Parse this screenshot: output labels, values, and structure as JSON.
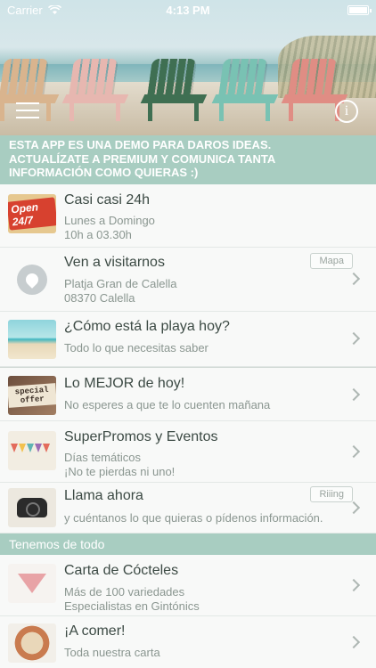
{
  "status_bar": {
    "carrier": "Carrier",
    "time": "4:13 PM"
  },
  "header": {
    "banner_lines": [
      "ESTA APP ES UNA DEMO PARA DAROS IDEAS.",
      "ACTUALÍZATE A PREMIUM Y COMUNICA TANTA",
      "INFORMACIÓN COMO QUIERAS :)"
    ]
  },
  "items": [
    {
      "title": "Casi casi 24h",
      "lines": [
        "Lunes a Domingo",
        "10h a 03.30h"
      ],
      "thumb_text": "Open 24/7"
    },
    {
      "title": "Ven a visitarnos",
      "lines": [
        "Platja Gran de Calella",
        "08370 Calella"
      ],
      "tag": "Mapa"
    },
    {
      "title": "¿Cómo está la playa hoy?",
      "lines": [
        "Todo lo que necesitas saber"
      ]
    },
    {
      "title": "Lo MEJOR de hoy!",
      "lines": [
        "No esperes a que te lo cuenten mañana"
      ],
      "thumb_text": "special offer"
    },
    {
      "title": "SuperPromos y Eventos",
      "lines": [
        "Días temáticos",
        "¡No te pierdas ni uno!"
      ]
    },
    {
      "title": "Llama ahora",
      "lines": [
        "y cuéntanos lo que quieras o pídenos información."
      ],
      "tag": "Riiing"
    }
  ],
  "section_title": "Tenemos de todo",
  "items2": [
    {
      "title": "Carta de Cócteles",
      "lines": [
        "Más de 100 variedades",
        "Especialistas en Gintónics"
      ]
    },
    {
      "title": "¡A comer!",
      "lines": [
        "Toda nuestra carta"
      ]
    }
  ],
  "colors": {
    "accent": "#a8cdc1",
    "title_text": "#3c4a44",
    "sub_text": "#8a9690"
  },
  "icons": {
    "menu": "hamburger-icon",
    "info": "info-icon",
    "pin": "location-pin-icon",
    "chevron": "chevron-right-icon",
    "wifi": "wifi-icon",
    "battery": "battery-icon"
  }
}
